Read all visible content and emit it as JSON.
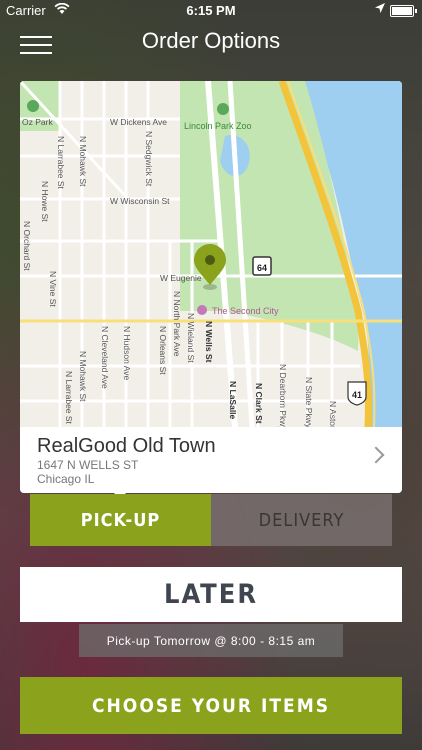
{
  "status": {
    "carrier": "Carrier",
    "time": "6:15 PM"
  },
  "nav": {
    "title": "Order Options"
  },
  "map": {
    "labels": {
      "oz_park": "Oz Park",
      "zoo": "Lincoln Park Zoo",
      "dickens": "W Dickens Ave",
      "wisconsin": "W Wisconsin St",
      "eugenie": "W Eugenie",
      "second_city": "The Second City",
      "larrabee": "N Larrabee St",
      "mohawk": "N Mohawk St",
      "sedgwick": "N Sedgwick St",
      "howe": "N Howe St",
      "orchard": "N Orchard St",
      "vine": "N Vine St",
      "cleveland": "N Cleveland Ave",
      "hudson": "N Hudson Ave",
      "mohawk2": "N Mohawk St",
      "larrabee2": "N Larrabee St",
      "north_park": "N North Park Ave",
      "orleans": "N Orleans St",
      "wieland": "N Wieland St",
      "wells": "N Wells St",
      "lasalle": "N LaSalle",
      "clark": "N Clark St",
      "dearborn": "N Dearborn Pkwy",
      "state": "N State Pkwy",
      "astor": "N Astor",
      "route64": "64",
      "route41": "41"
    }
  },
  "location": {
    "name": "RealGood Old Town",
    "street": "1647 N WELLS ST",
    "city": "Chicago IL"
  },
  "tabs": {
    "pickup": "PICK-UP",
    "delivery": "DELIVERY"
  },
  "later": "LATER",
  "pickup_time": "Pick-up Tomorrow @ 8:00 - 8:15 am",
  "cta": "CHOOSE YOUR ITEMS"
}
